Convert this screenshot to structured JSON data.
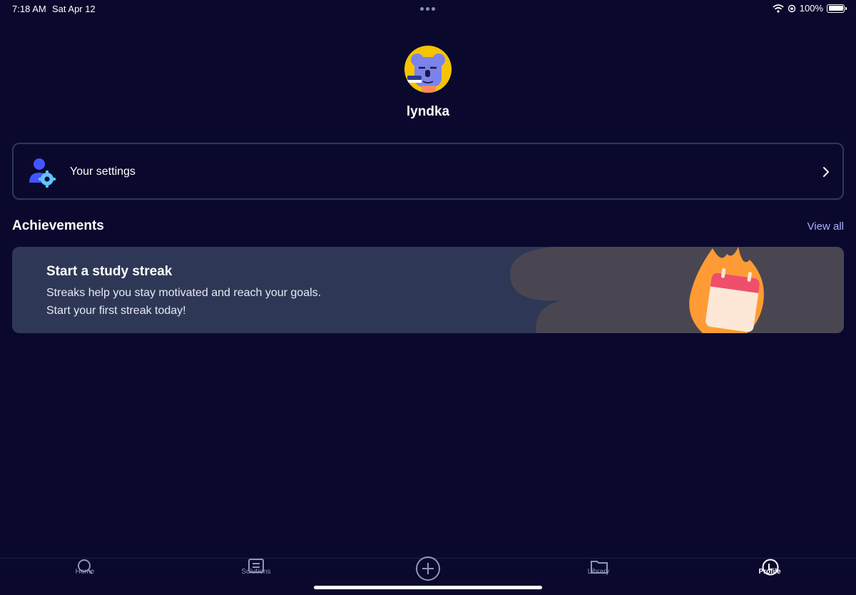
{
  "status_bar": {
    "time": "7:18 AM",
    "date": "Sat Apr 12",
    "battery": "100%",
    "battery_level": 1.0,
    "icons": [
      "wifi-icon",
      "orientation-lock-icon",
      "battery-icon"
    ]
  },
  "profile": {
    "username": "lyndka",
    "avatar_icon": "koala-avatar-icon"
  },
  "settings": {
    "label": "Your settings",
    "icon": "user-gear-icon"
  },
  "achievements": {
    "title": "Achievements",
    "view_all": "View all",
    "card": {
      "title": "Start a study streak",
      "line1": "Streaks help you stay motivated and reach your goals.",
      "line2": "Start your first streak today!",
      "illustration": "flaming-calendar-icon"
    }
  },
  "tabs": [
    {
      "label": "Home",
      "icon": "search-icon",
      "active": false
    },
    {
      "label": "Solutions",
      "icon": "solutions-book-icon",
      "active": false
    },
    {
      "label": "",
      "icon": "plus-circle-icon",
      "active": false
    },
    {
      "label": "Library",
      "icon": "folder-icon",
      "active": false
    },
    {
      "label": "Profile",
      "icon": "profile-icon",
      "active": true
    }
  ],
  "colors": {
    "background": "#0a092d",
    "card": "#2e3856",
    "accent_link": "#a8b1ff",
    "avatar_bg": "#f5c400",
    "flame": "#ff9b34",
    "calendar_header": "#ef4f6b"
  }
}
